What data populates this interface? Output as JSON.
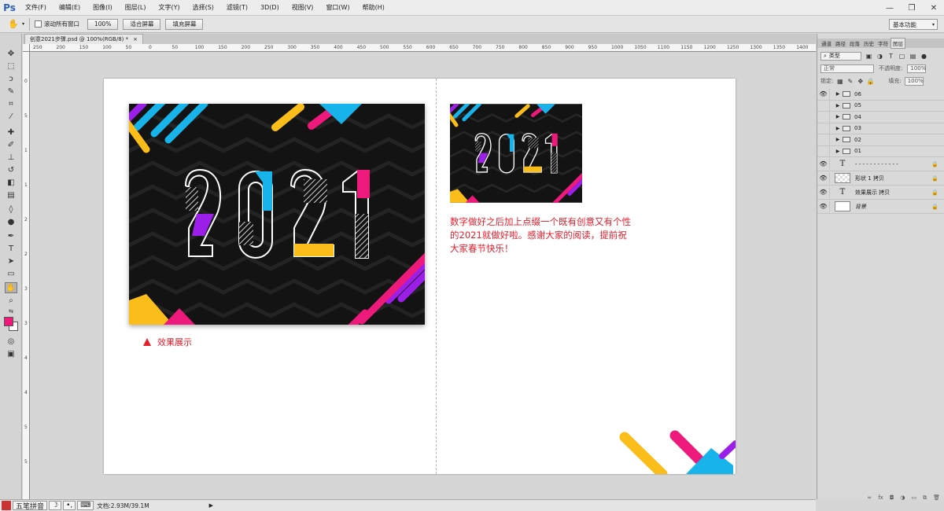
{
  "app": {
    "logo": "Ps"
  },
  "menu": [
    "文件(F)",
    "编辑(E)",
    "图像(I)",
    "图层(L)",
    "文字(Y)",
    "选择(S)",
    "滤镜(T)",
    "3D(D)",
    "视图(V)",
    "窗口(W)",
    "帮助(H)"
  ],
  "window_controls": [
    "—",
    "❐",
    "✕"
  ],
  "options": {
    "scroll_all_label": "滚动所有窗口",
    "zoom_value": "100%",
    "fit_screen": "适合屏幕",
    "fill_screen": "填充屏幕",
    "workspace": "基本功能"
  },
  "doc_tab": {
    "title": "创意2021步骤.psd @ 100%(RGB/8) *",
    "close": "×"
  },
  "ruler_h_ticks": [
    "250",
    "200",
    "150",
    "100",
    "50",
    "0",
    "50",
    "100",
    "150",
    "200",
    "250",
    "300",
    "350",
    "400",
    "450",
    "500",
    "550",
    "600",
    "650",
    "700",
    "750",
    "800",
    "850",
    "900",
    "950",
    "1000",
    "1050",
    "1100",
    "1150",
    "1200",
    "1250",
    "1300",
    "1350",
    "1400"
  ],
  "ruler_v_ticks": [
    "0",
    "5",
    "1",
    "1",
    "2",
    "2",
    "3",
    "3",
    "4",
    "4",
    "5",
    "5"
  ],
  "canvas": {
    "caption": "效果展示",
    "description": "数字做好之后加上点缀一个既有创意又有个性的2021就做好啦。感谢大家的阅读，提前祝大家春节快乐！",
    "artwork_text": "2021",
    "colors": {
      "background": "#131313",
      "cyan": "#17b4ec",
      "yellow": "#fbbd1a",
      "pink": "#ee1a7b",
      "purple": "#9b1fe8",
      "white": "#ffffff"
    }
  },
  "panel": {
    "tabs": [
      "通道",
      "路径",
      "段落",
      "历史",
      "字符",
      "图层"
    ],
    "filter_type": "类型",
    "blend_mode": "正常",
    "opacity_label": "不透明度:",
    "opacity_value": "100%",
    "lock_label": "锁定:",
    "fill_label": "填充:",
    "fill_value": "100%",
    "layers": [
      {
        "name": "06",
        "kind": "group",
        "visible": true
      },
      {
        "name": "05",
        "kind": "group",
        "visible": false
      },
      {
        "name": "04",
        "kind": "group",
        "visible": false
      },
      {
        "name": "03",
        "kind": "group",
        "visible": false
      },
      {
        "name": "02",
        "kind": "group",
        "visible": false
      },
      {
        "name": "01",
        "kind": "group",
        "visible": false
      },
      {
        "name": "- - - - - - - - - - - -",
        "kind": "text",
        "visible": true,
        "locked": true
      },
      {
        "name": "形状 1 拷贝",
        "kind": "shape",
        "visible": true,
        "locked": true
      },
      {
        "name": "效果展示 拷贝",
        "kind": "text",
        "visible": true,
        "locked": true
      },
      {
        "name": "背景",
        "kind": "background",
        "visible": true,
        "locked": true
      }
    ],
    "footer_icons": [
      "∞",
      "fx",
      "◘",
      "◑",
      "▭",
      "⧉",
      "🗑"
    ]
  },
  "status": {
    "ime_name": "五笔拼音",
    "ime_moon": "☽",
    "ime_punct": "•,",
    "ime_kbd": "⌨",
    "doc_info": "文档:2.93M/39.1M",
    "arrow": "▶"
  }
}
